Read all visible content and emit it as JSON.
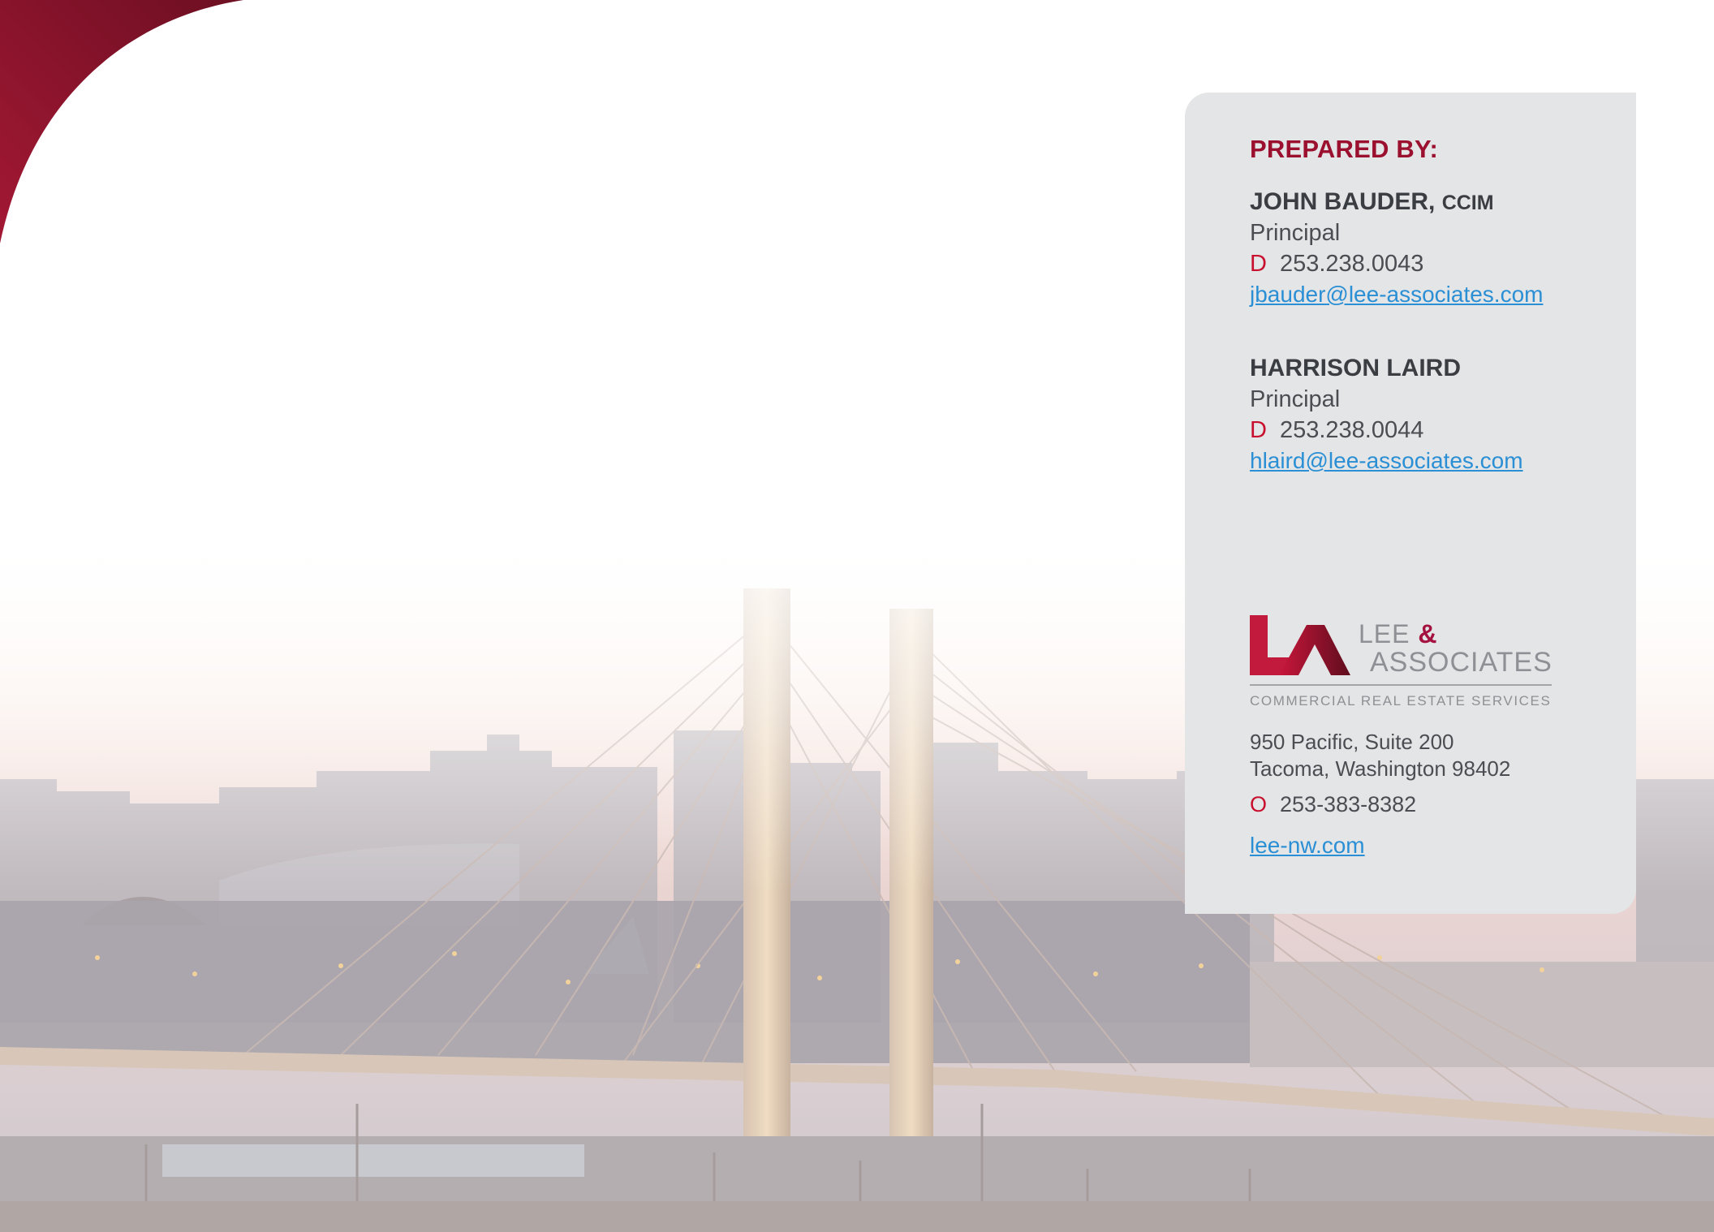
{
  "card": {
    "heading": "PREPARED BY:",
    "contacts": [
      {
        "name": "JOHN BAUDER,",
        "credential": "CCIM",
        "title": "Principal",
        "phone_prefix": "D",
        "phone": "253.238.0043",
        "email": "jbauder@lee-associates.com"
      },
      {
        "name": "HARRISON LAIRD",
        "credential": "",
        "title": "Principal",
        "phone_prefix": "D",
        "phone": "253.238.0044",
        "email": "hlaird@lee-associates.com"
      }
    ],
    "logo": {
      "name_line1": "LEE",
      "ampersand": "&",
      "name_line2": "ASSOCIATES",
      "tagline": "COMMERCIAL REAL ESTATE SERVICES"
    },
    "address_line1": "950 Pacific, Suite 200",
    "address_line2": "Tacoma, Washington 98402",
    "office_phone_prefix": "O",
    "office_phone": "253-383-8382",
    "website": "lee-nw.com"
  },
  "colors": {
    "brand_red": "#9b0f2f",
    "link_blue": "#2a8fd4",
    "card_gray": "#e4e5e6"
  }
}
